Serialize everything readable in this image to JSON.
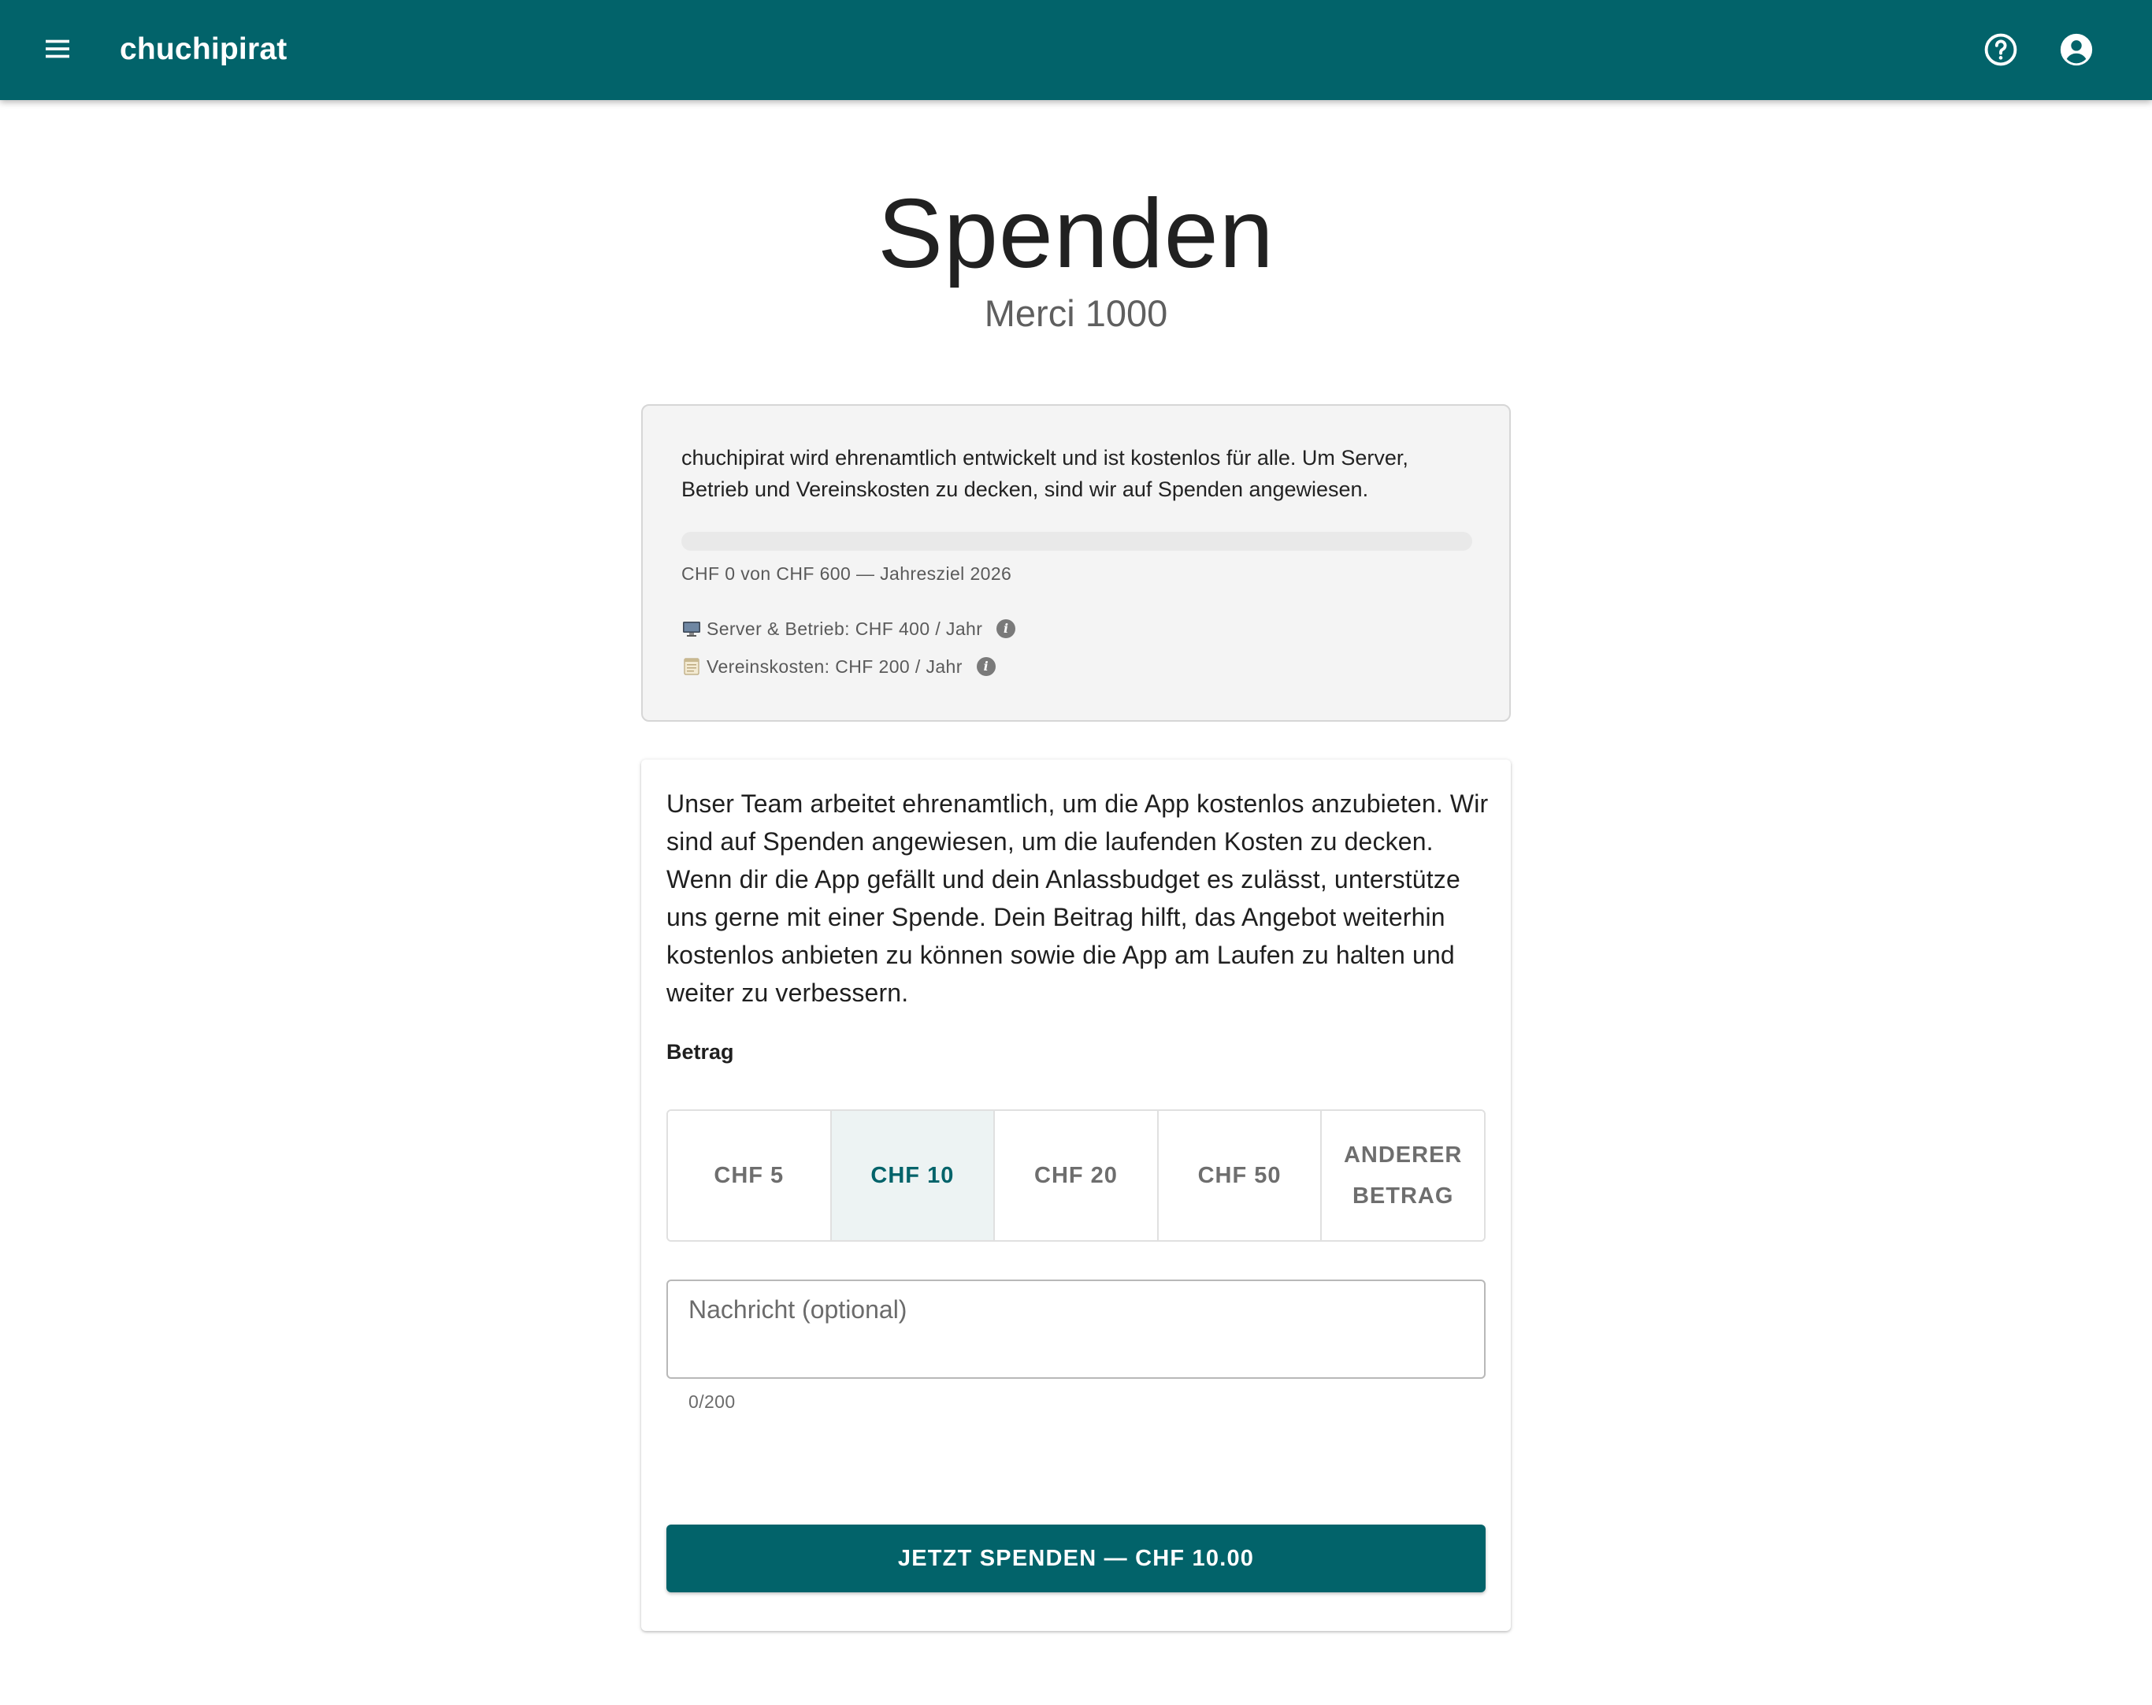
{
  "app": {
    "title": "chuchipirat",
    "icons": {
      "menu": "menu-icon",
      "help": "help-circle-icon",
      "account": "account-circle-icon"
    }
  },
  "page": {
    "title": "Spenden",
    "subtitle": "Merci 1000"
  },
  "info_card": {
    "text": "chuchipirat wird ehrenamtlich entwickelt und ist kostenlos für alle. Um Server, Betrieb und Vereinskosten zu decken, sind wir auf Spenden angewiesen.",
    "progress_fraction": 0.0,
    "progress_label": "CHF 0 von CHF 600 — Jahresziel 2026",
    "costs": [
      {
        "icon": "monitor-icon",
        "label": "Server & Betrieb: CHF 400 / Jahr"
      },
      {
        "icon": "notepad-icon",
        "label": "Vereinskosten: CHF 200 / Jahr"
      }
    ]
  },
  "donation": {
    "intro": "Unser Team arbeitet ehrenamtlich, um die App kostenlos anzubieten. Wir sind auf Spenden angewiesen, um die laufenden Kosten zu decken. Wenn dir die App gefällt und dein Anlassbudget es zulässt, unterstütze uns gerne mit einer Spende. Dein Beitrag hilft, das Angebot weiterhin kostenlos anbieten zu können sowie die App am Laufen zu halten und weiter zu verbessern.",
    "amount_label": "Betrag",
    "amount_options": [
      "CHF 5",
      "CHF 10",
      "CHF 20",
      "CHF 50",
      "ANDERER BETRAG"
    ],
    "selected_amount": "CHF 10",
    "message": {
      "placeholder": "Nachricht (optional)",
      "value": "",
      "counter": "0/200"
    },
    "submit_label": "JETZT SPENDEN — CHF 10.00"
  },
  "colors": {
    "primary": "#02636a",
    "card_bg": "#f4f4f4",
    "selected_bg": "#edf3f3"
  }
}
